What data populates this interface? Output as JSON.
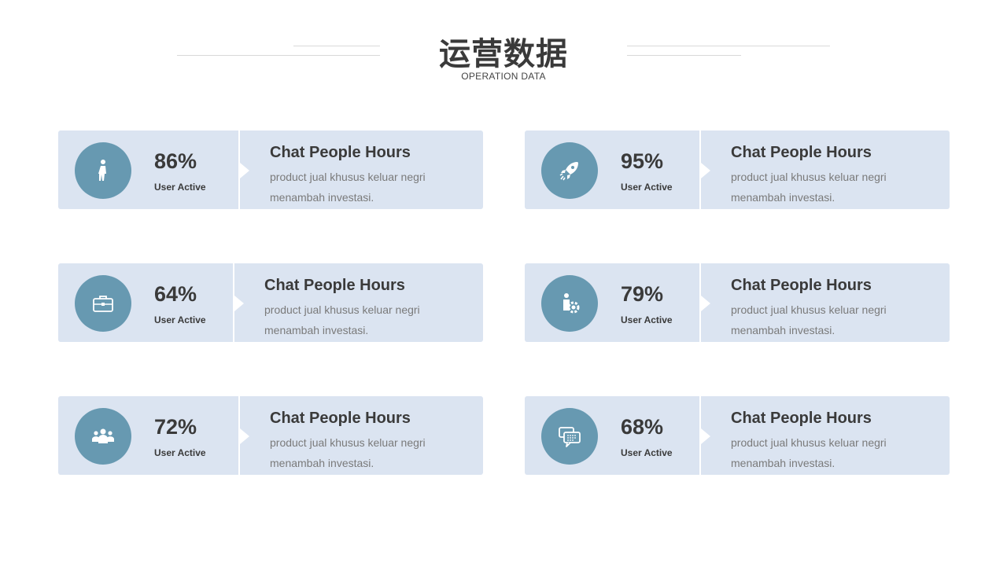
{
  "header": {
    "title": "运营数据",
    "subtitle": "OPERATION DATA"
  },
  "colors": {
    "card_bg": "#dbe4f1",
    "circle_bg": "#6799b1",
    "text_dark": "#3a3a3a",
    "text_muted": "#7a7a7a"
  },
  "cards": [
    {
      "icon": "walking-person-icon",
      "percent": "86%",
      "percent_label": "User Active",
      "title": "Chat People Hours",
      "description": "product jual khusus keluar negri menambah investasi."
    },
    {
      "icon": "rocket-icon",
      "percent": "95%",
      "percent_label": "User Active",
      "title": "Chat People Hours",
      "description": "product jual khusus keluar negri menambah investasi."
    },
    {
      "icon": "briefcase-icon",
      "percent": "64%",
      "percent_label": "User Active",
      "title": "Chat People Hours",
      "description": "product jual khusus keluar negri menambah investasi."
    },
    {
      "icon": "person-gear-icon",
      "percent": "79%",
      "percent_label": "User Active",
      "title": "Chat People Hours",
      "description": "product jual khusus keluar negri menambah investasi."
    },
    {
      "icon": "team-icon",
      "percent": "72%",
      "percent_label": "User Active",
      "title": "Chat People Hours",
      "description": "product jual khusus keluar negri menambah investasi."
    },
    {
      "icon": "chat-bubbles-icon",
      "percent": "68%",
      "percent_label": "User Active",
      "title": "Chat People Hours",
      "description": "product jual khusus keluar negri menambah investasi."
    }
  ]
}
